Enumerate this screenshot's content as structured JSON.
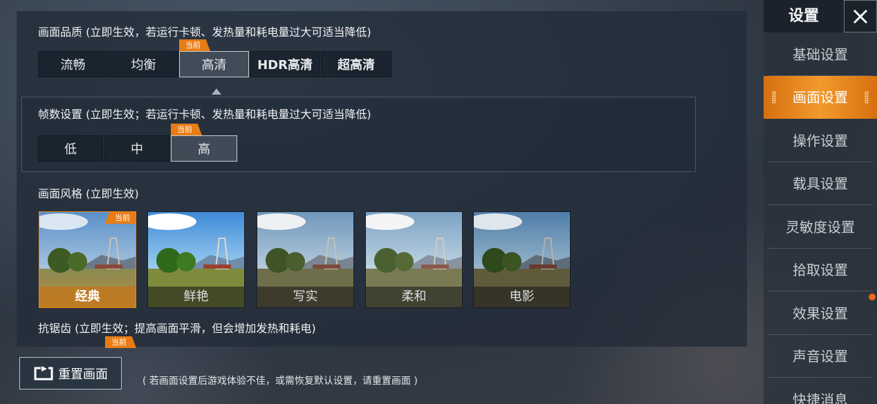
{
  "sidebar": {
    "title": "设置",
    "items": [
      {
        "label": "基础设置"
      },
      {
        "label": "画面设置"
      },
      {
        "label": "操作设置"
      },
      {
        "label": "载具设置"
      },
      {
        "label": "灵敏度设置"
      },
      {
        "label": "拾取设置"
      },
      {
        "label": "效果设置"
      },
      {
        "label": "声音设置"
      },
      {
        "label": "快捷消息"
      }
    ],
    "active_index": 1
  },
  "quality": {
    "title": "画面品质 (立即生效，若运行卡顿、发热量和耗电量过大可适当降低)",
    "options": [
      "流畅",
      "均衡",
      "高清",
      "HDR高清",
      "超高清"
    ],
    "selected": "高清"
  },
  "fps": {
    "title": "帧数设置 (立即生效；若运行卡顿、发热量和耗电量过大可适当降低)",
    "options": [
      "低",
      "中",
      "高"
    ],
    "selected": "高"
  },
  "style": {
    "title": "画面风格 (立即生效)",
    "options": [
      "经典",
      "鲜艳",
      "写实",
      "柔和",
      "电影"
    ],
    "selected": "经典"
  },
  "antialias": {
    "title": "抗锯齿 (立即生效；提高画面平滑，但会增加发热和耗电)"
  },
  "current_tag": "当前",
  "reset": {
    "label": "重置画面",
    "note": "( 若画面设置后游戏体验不佳，或需恢复默认设置，请重置画面 )"
  },
  "colors": {
    "accent": "#e87c14",
    "panel": "#222c38"
  }
}
